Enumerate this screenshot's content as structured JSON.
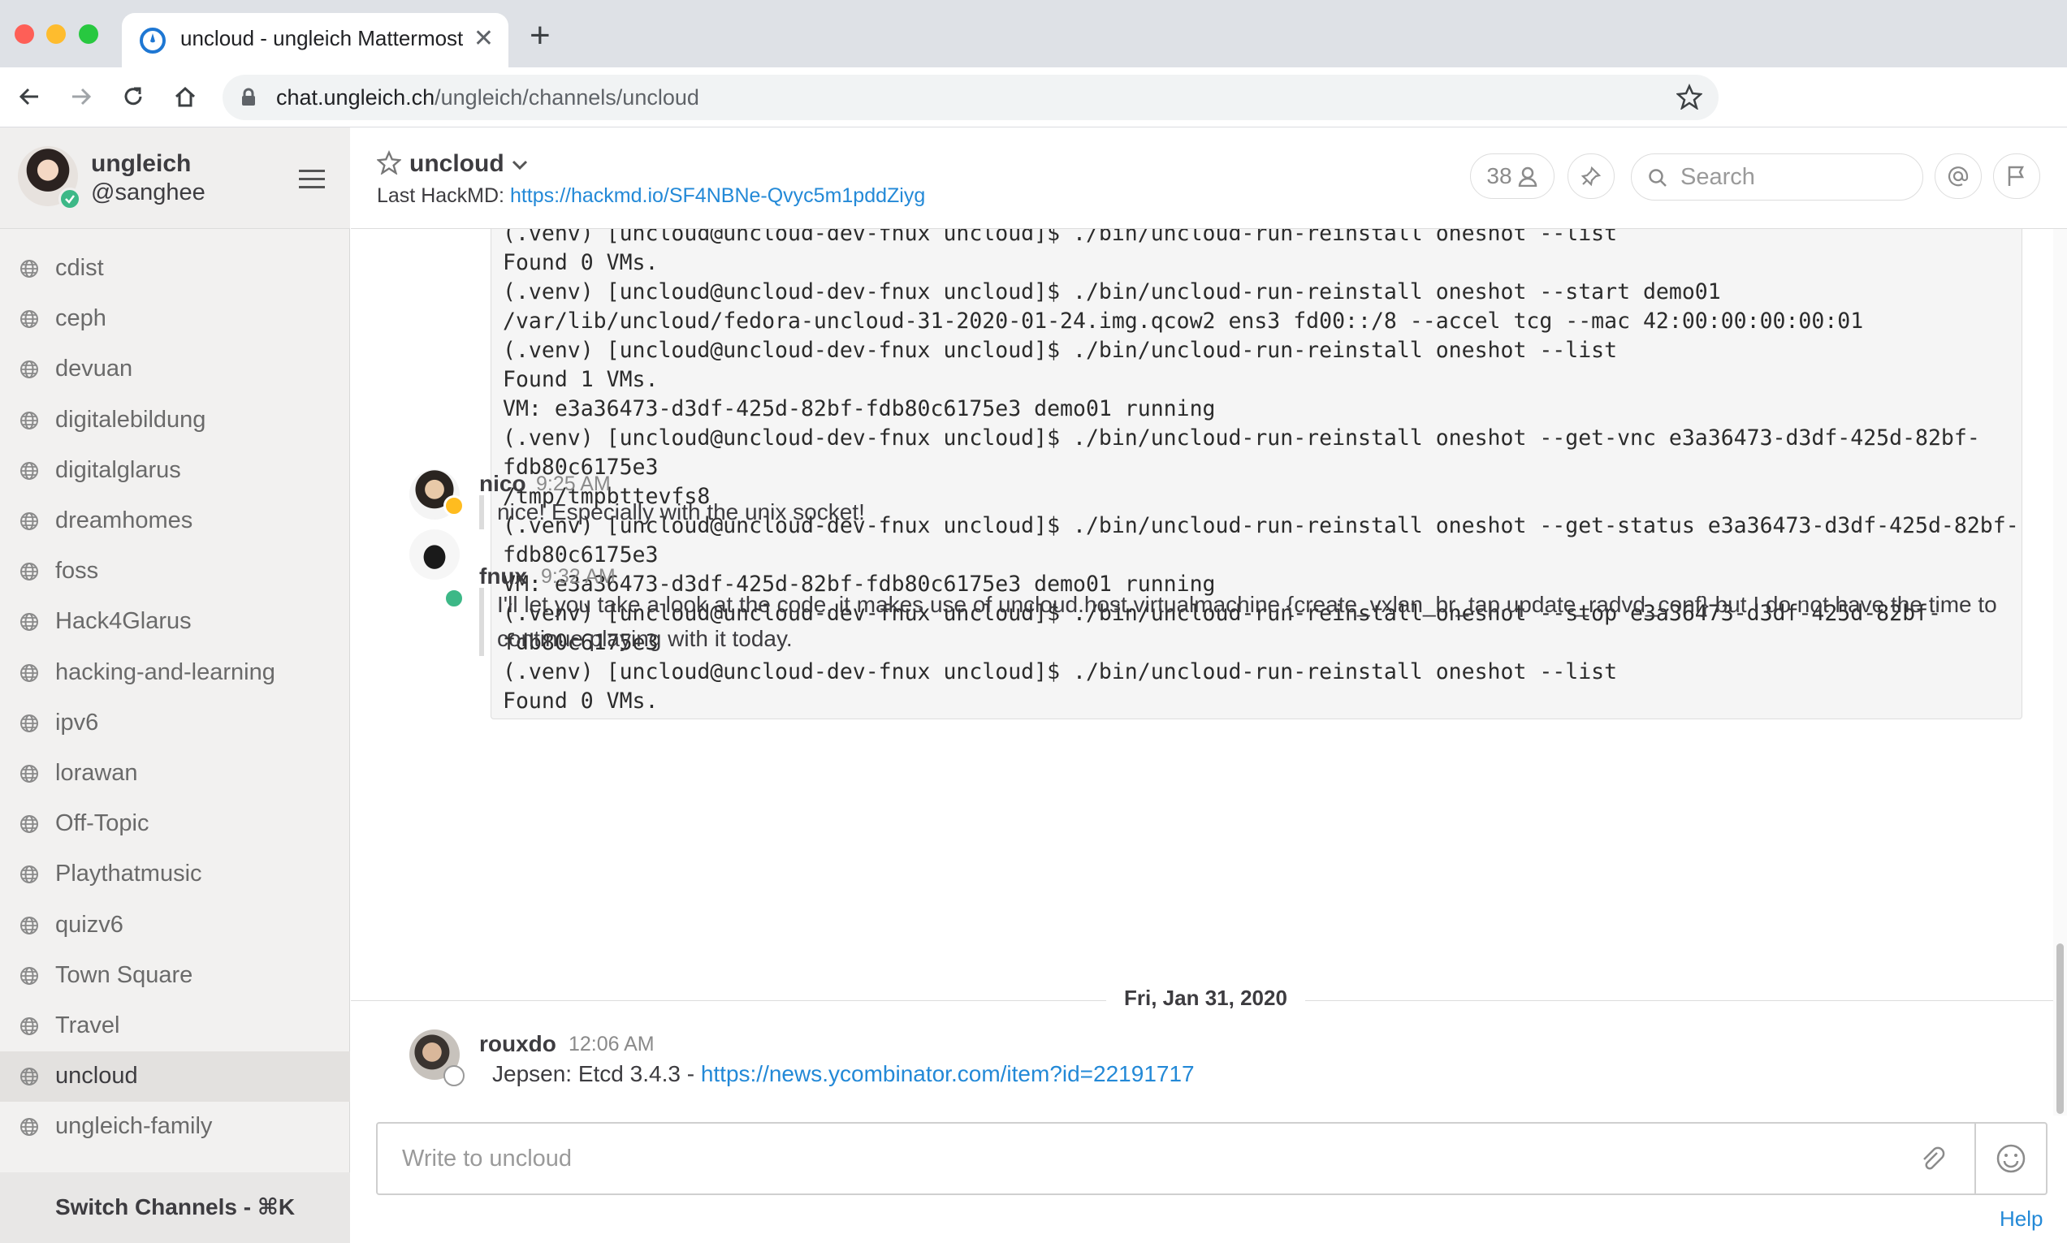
{
  "browser": {
    "tab_title": "uncloud - ungleich Mattermost",
    "url_host": "chat.ungleich.ch",
    "url_path": "/ungleich/channels/uncloud"
  },
  "sidebar": {
    "team_name": "ungleich",
    "username": "@sanghee",
    "channels": [
      {
        "label": "cdist"
      },
      {
        "label": "ceph"
      },
      {
        "label": "devuan"
      },
      {
        "label": "digitalebildung"
      },
      {
        "label": "digitalglarus"
      },
      {
        "label": "dreamhomes"
      },
      {
        "label": "foss"
      },
      {
        "label": "Hack4Glarus"
      },
      {
        "label": "hacking-and-learning"
      },
      {
        "label": "ipv6"
      },
      {
        "label": "lorawan"
      },
      {
        "label": "Off-Topic"
      },
      {
        "label": "Playthatmusic"
      },
      {
        "label": "quizv6"
      },
      {
        "label": "Town Square"
      },
      {
        "label": "Travel"
      },
      {
        "label": "uncloud",
        "active": true
      },
      {
        "label": "ungleich-family"
      }
    ],
    "switch_channels": "Switch Channels - ⌘K"
  },
  "channel_header": {
    "name": "uncloud",
    "purpose_prefix": "Last HackMD: ",
    "purpose_link": "https://hackmd.io/SF4NBNe-Qvyc5m1pddZiyg",
    "member_count": "38",
    "search_placeholder": "Search"
  },
  "code_lines": [
    "(.venv) [uncloud@uncloud-dev-fnux uncloud]$ ./bin/uncloud-run-reinstall oneshot --list",
    "Found 0 VMs.",
    "(.venv) [uncloud@uncloud-dev-fnux uncloud]$ ./bin/uncloud-run-reinstall oneshot --start demo01",
    "/var/lib/uncloud/fedora-uncloud-31-2020-01-24.img.qcow2 ens3 fd00::/8 --accel tcg --mac 42:00:00:00:00:01",
    "(.venv) [uncloud@uncloud-dev-fnux uncloud]$ ./bin/uncloud-run-reinstall oneshot --list",
    "Found 1 VMs.",
    "VM: e3a36473-d3df-425d-82bf-fdb80c6175e3 demo01 running",
    "(.venv) [uncloud@uncloud-dev-fnux uncloud]$ ./bin/uncloud-run-reinstall oneshot --get-vnc e3a36473-d3df-425d-82bf-",
    "fdb80c6175e3",
    "/tmp/tmpbttevfs8",
    "(.venv) [uncloud@uncloud-dev-fnux uncloud]$ ./bin/uncloud-run-reinstall oneshot --get-status e3a36473-d3df-425d-82bf-",
    "fdb80c6175e3",
    "VM: e3a36473-d3df-425d-82bf-fdb80c6175e3 demo01 running",
    "(.venv) [uncloud@uncloud-dev-fnux uncloud]$ ./bin/uncloud-run-reinstall oneshot --stop e3a36473-d3df-425d-82bf-",
    "fdb80c6175e3",
    "(.venv) [uncloud@uncloud-dev-fnux uncloud]$ ./bin/uncloud-run-reinstall oneshot --list",
    "Found 0 VMs."
  ],
  "posts": [
    {
      "user": "nico",
      "time": "9:25 AM",
      "text": "nice! Especially with the unix socket!"
    },
    {
      "user": "fnux",
      "time": "9:32 AM",
      "text": "I'll let you take a look at the code, it makes use of uncloud.host.virtualmachine.{create_vxlan_br_tap,update_radvd_conf} but I do not have the time to continue playing with it today."
    },
    {
      "user": "rouxdo",
      "time": "12:06 AM",
      "text_prefix": "Jepsen: Etcd 3.4.3 - ",
      "link": "https://news.ycombinator.com/item?id=22191717"
    }
  ],
  "date_separator": "Fri, Jan 31, 2020",
  "composer": {
    "placeholder": "Write to uncloud"
  },
  "help_label": "Help",
  "colors": {
    "link": "#2389d7",
    "online": "#3db887",
    "away": "#ffbc1f"
  }
}
